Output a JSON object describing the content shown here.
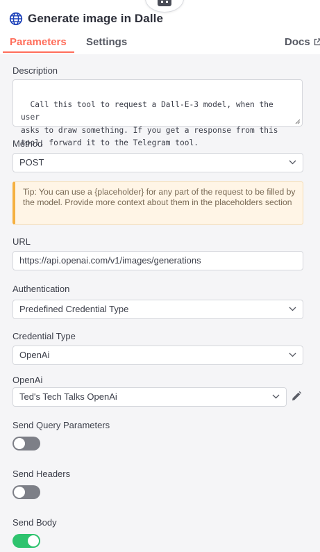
{
  "header": {
    "title": "Generate image in Dalle",
    "node_icon": "robot-icon",
    "title_icon": "globe-icon"
  },
  "tabs": {
    "parameters": "Parameters",
    "settings": "Settings",
    "docs": "Docs"
  },
  "description": {
    "label": "Description",
    "value": "Call this tool to request a Dall-E-3 model, when the user\nasks to draw something. If you get a response from this\ntool, forward it to the Telegram tool."
  },
  "method": {
    "label": "Method",
    "value": "POST"
  },
  "tip": {
    "text": "Tip: You can use a {placeholder} for any part of the request to be filled by the model. Provide more context about them in the placeholders section"
  },
  "url": {
    "label": "URL",
    "value": "https://api.openai.com/v1/images/generations"
  },
  "authentication": {
    "label": "Authentication",
    "value": "Predefined Credential Type"
  },
  "credential_type": {
    "label": "Credential Type",
    "value": "OpenAi"
  },
  "openai": {
    "label": "OpenAi",
    "value": "Ted's Tech Talks OpenAi"
  },
  "send_query": {
    "label": "Send Query Parameters",
    "enabled": false
  },
  "send_headers": {
    "label": "Send Headers",
    "enabled": false
  },
  "send_body": {
    "label": "Send Body",
    "enabled": true
  },
  "colors": {
    "accent": "#ff6d5a",
    "toggle_on": "#2ec36e",
    "toggle_off": "#7d7f87",
    "tip_border": "#f5b040"
  }
}
